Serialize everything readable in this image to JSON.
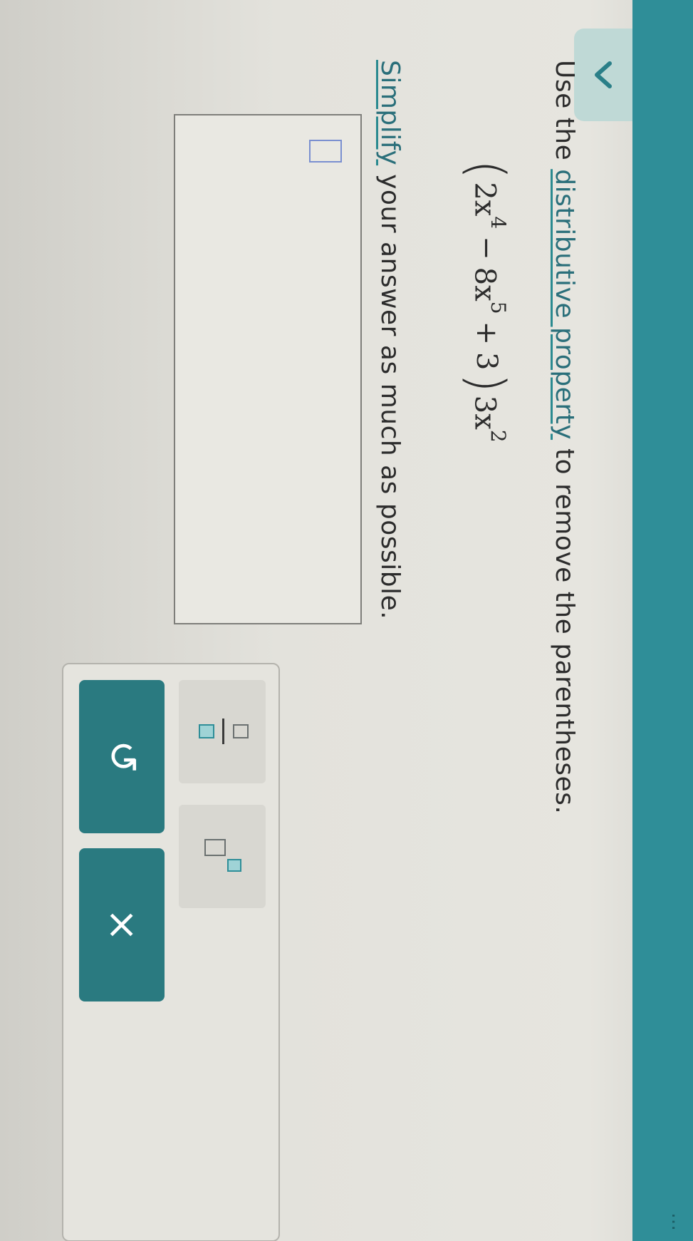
{
  "header": {
    "partial_text": "…"
  },
  "collapse_tab": {
    "icon": "chevron-down-icon"
  },
  "question": {
    "prompt_prefix": "Use the ",
    "prompt_link": "distributive property",
    "prompt_suffix": " to remove the parentheses.",
    "expression": {
      "open_paren": "(",
      "term1_coef": "2x",
      "term1_exp": "4",
      "op1": "−",
      "term2_coef": "8x",
      "term2_exp": "5",
      "op2": "+",
      "term3": "3",
      "close_paren": ")",
      "multiplier_coef": "3x",
      "multiplier_exp": "2"
    },
    "instruction_link": "Simplify",
    "instruction_suffix": " your answer as much as possible."
  },
  "answer": {
    "value": ""
  },
  "keypad": {
    "fraction_key_icon": "fraction-template-icon",
    "exponent_key_icon": "exponent-template-icon",
    "undo_button_icon": "undo-icon",
    "undo_glyph": "↺",
    "clear_button_icon": "close-icon",
    "clear_glyph": "×"
  },
  "colors": {
    "accent_teal": "#2f8e98",
    "button_teal": "#2a7a80",
    "link_color": "#2a6f7a",
    "slot_highlight": "#9fd3d6"
  }
}
